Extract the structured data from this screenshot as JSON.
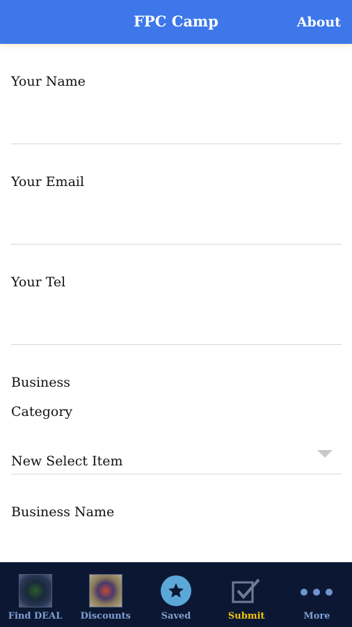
{
  "header": {
    "title": "FPC Camp",
    "about_label": "About"
  },
  "form": {
    "name_label": "Your Name",
    "name_value": "",
    "email_label": "Your Email",
    "email_value": "",
    "tel_label": "Your Tel",
    "tel_value": "",
    "category_label_line1": "Business",
    "category_label_line2": "Category",
    "category_selected": "New Select Item",
    "business_name_label": "Business Name",
    "business_name_value": ""
  },
  "tabs": [
    {
      "label": "Find DEAL",
      "icon": "find-deal-thumbnail"
    },
    {
      "label": "Discounts",
      "icon": "discounts-thumbnail"
    },
    {
      "label": "Saved",
      "icon": "star-icon"
    },
    {
      "label": "Submit",
      "icon": "checkbox-icon",
      "active": true
    },
    {
      "label": "More",
      "icon": "more-dots-icon"
    }
  ],
  "colors": {
    "header_bg": "#3d77ea",
    "tabbar_bg": "#0c1833",
    "active_tab": "#f2c40f",
    "inactive_tab": "#7f9fcf"
  }
}
